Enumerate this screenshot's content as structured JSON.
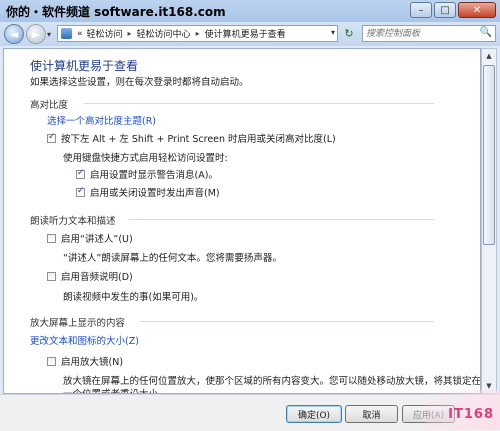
{
  "window": {
    "title_watermark": "你的・软件频道 software.it168.com",
    "buttons": {
      "minimize": "–",
      "maximize": "□",
      "close": "✕"
    }
  },
  "address_bar": {
    "back_glyph": "◄",
    "forward_glyph": "►",
    "crumbs": [
      "«",
      "轻松访问",
      "轻松访问中心",
      "使计算机更易于查看"
    ],
    "refresh_glyph": "↻",
    "search_placeholder": "搜索控制面板",
    "search_icon_glyph": "🔍"
  },
  "page": {
    "title": "使计算机更易于查看",
    "description": "如果选择这些设置，则在每次登录时都将自动启动。",
    "sections": {
      "contrast": {
        "heading": "高对比度",
        "link": "选择一个高对比度主题(R)",
        "toggle_label": "按下左 Alt + 左 Shift + Print Screen 时启用或关闭高对比度(L)",
        "sub_heading": "使用键盘快捷方式启用轻松访问设置时:",
        "warning_label": "启用设置时显示警告消息(A)。",
        "sound_label": "启用或关闭设置时发出声音(M)"
      },
      "narrator": {
        "heading": "朗读听力文本和描述",
        "narrator_label": "启用“讲述人”(U)",
        "narrator_desc": "“讲述人”朗读屏幕上的任何文本。您将需要扬声器。",
        "audio_desc_label": "启用音频说明(D)",
        "audio_desc_text": "朗读视频中发生的事(如果可用)。"
      },
      "magnify": {
        "heading": "放大屏幕上显示的内容",
        "link": "更改文本和图标的大小(Z)",
        "magnifier_label": "启用放大镜(N)",
        "magnifier_desc_1": "放大镜在屏幕上的任何位置放大，使那个区域的所有内容变大。您可以随处移动放大镜，将其锁定在",
        "magnifier_desc_2": "一个位置或者重设大小。"
      }
    }
  },
  "checkbox_states": {
    "contrast_toggle": true,
    "warning": true,
    "sound": true,
    "narrator": false,
    "audio_desc": false,
    "magnifier": false
  },
  "footer": {
    "ok": "确定(O)",
    "cancel": "取消",
    "apply": "应用(A)"
  },
  "corner_watermark": "IT168",
  "colors": {
    "link": "#1a4ed2",
    "title": "#1e3a8c"
  }
}
